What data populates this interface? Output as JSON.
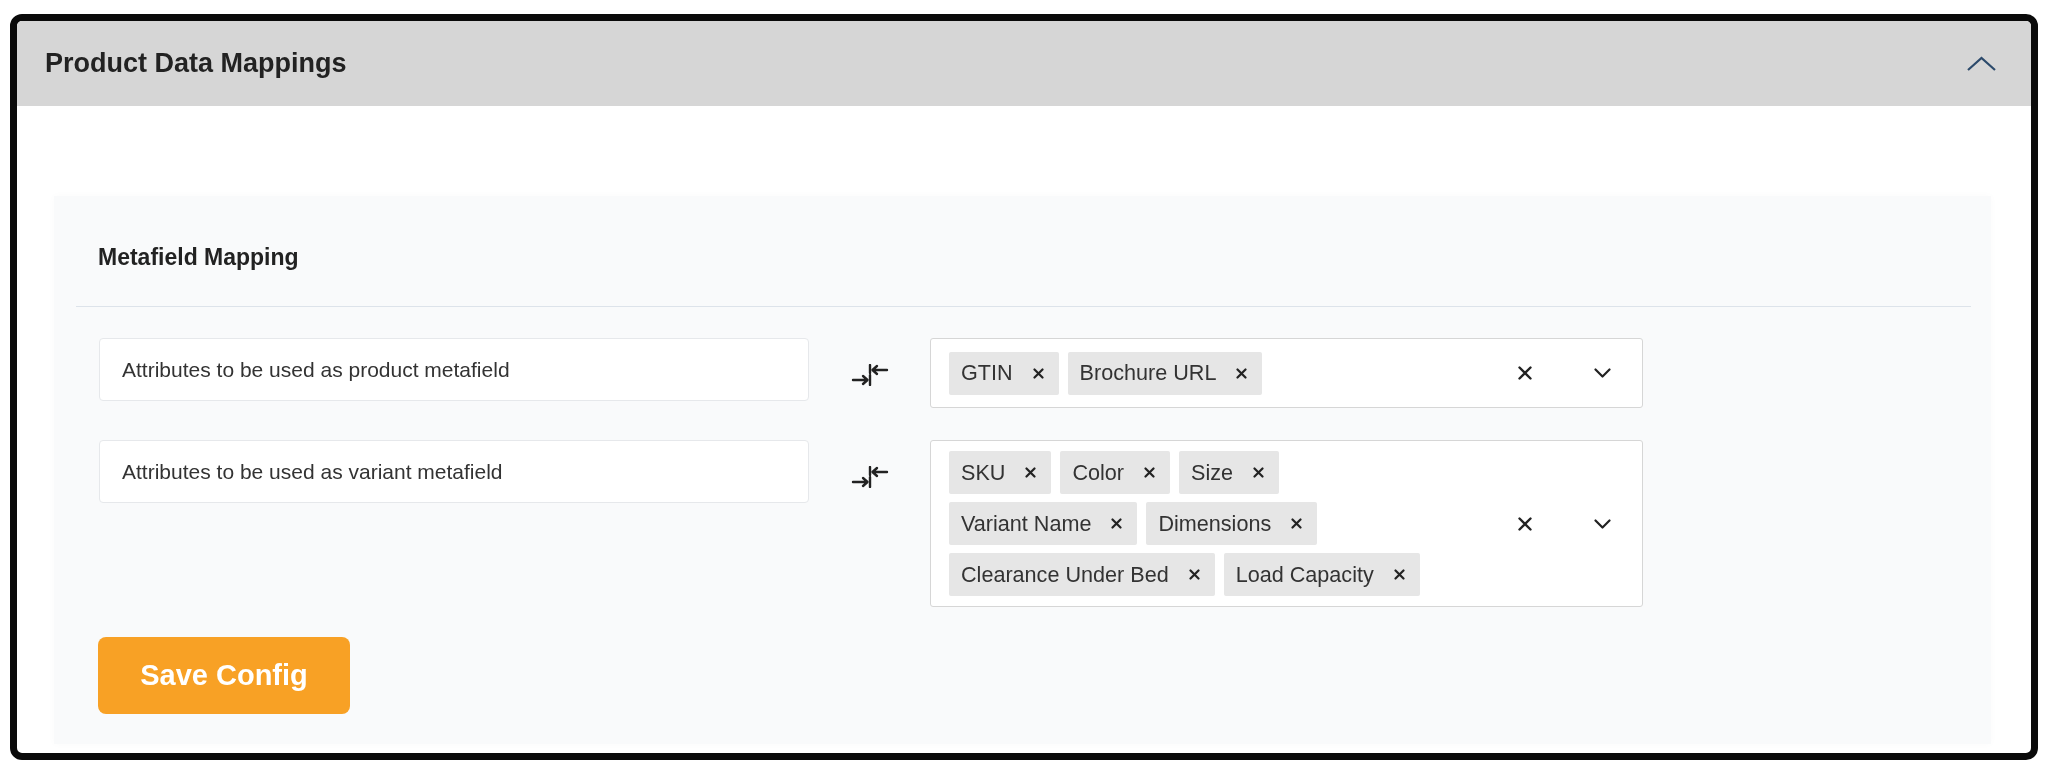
{
  "panel": {
    "title": "Product Data Mappings",
    "expanded": true
  },
  "section": {
    "title": "Metafield Mapping"
  },
  "mappings": [
    {
      "label": "Attributes to be used as product metafield",
      "tags": [
        "GTIN",
        "Brochure URL"
      ]
    },
    {
      "label": "Attributes to be used as variant metafield",
      "tags": [
        "SKU",
        "Color",
        "Size",
        "Variant Name",
        "Dimensions",
        "Clearance Under Bed",
        "Load Capacity"
      ]
    }
  ],
  "save_button": {
    "label": "Save Config"
  }
}
